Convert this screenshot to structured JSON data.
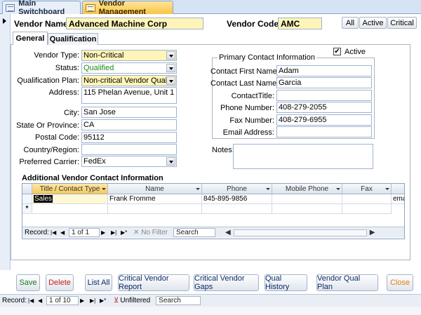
{
  "tabs": [
    {
      "label": "Main Switchboard"
    },
    {
      "label": "Vendor Management"
    }
  ],
  "header": {
    "vendor_name_label": "Vendor Name:",
    "vendor_name": "Advanced Machine Corp",
    "vendor_code_label": "Vendor Code:",
    "vendor_code": "AMC",
    "filter_buttons": [
      "All",
      "Active",
      "Critical"
    ]
  },
  "page_tabs": [
    "General",
    "Qualification"
  ],
  "general": {
    "vendor_type": {
      "label": "Vendor Type:",
      "value": "Non-Critical"
    },
    "status": {
      "label": "Status:",
      "value": "Qualified"
    },
    "qual_plan": {
      "label": "Qualification Plan:",
      "value": "Non-critical Vendor Qual"
    },
    "address": {
      "label": "Address:",
      "value": "115 Phelan Avenue, Unit 1"
    },
    "city": {
      "label": "City:",
      "value": "San Jose"
    },
    "state": {
      "label": "State Or Province:",
      "value": "CA"
    },
    "postal": {
      "label": "Postal Code:",
      "value": "95112"
    },
    "country": {
      "label": "Country/Region:",
      "value": ""
    },
    "carrier": {
      "label": "Preferred Carrier:",
      "value": "FedEx"
    }
  },
  "primary_contact": {
    "title": "Primary Contact Information",
    "active_label": "Active",
    "active_checked": true,
    "first_name": {
      "label": "Contact First Name:",
      "value": "Adam"
    },
    "last_name": {
      "label": "Contact Last Name:",
      "value": "Garcia"
    },
    "contact_title": {
      "label": "ContactTitle:",
      "value": ""
    },
    "phone": {
      "label": "Phone Number:",
      "value": "408-279-2055"
    },
    "fax": {
      "label": "Fax Number:",
      "value": "408-279-6955"
    },
    "email": {
      "label": "Email Address:",
      "value": ""
    }
  },
  "notes": {
    "label": "Notes:",
    "value": ""
  },
  "additional": {
    "title": "Additional Vendor Contact Information",
    "columns": [
      "Title / Contact Type",
      "Name",
      "Phone",
      "Mobile Phone",
      "Fax"
    ],
    "row": {
      "title": "Sales",
      "name": "Frank Fromme",
      "phone": "845-895-9856",
      "mobile": "",
      "fax": "",
      "overflow": "ema"
    },
    "new_row_marker": "*",
    "nav": {
      "record_label": "Record:",
      "position": "1 of 1",
      "filter": "No Filter",
      "search": "Search"
    }
  },
  "footer_buttons": [
    {
      "label": "Save",
      "color": "#1a7a1a"
    },
    {
      "label": "Delete",
      "color": "#c0201a"
    },
    {
      "label": "List All",
      "color": "#0c2a66"
    },
    {
      "label": "Critical Vendor Report",
      "color": "#0c2a66"
    },
    {
      "label": "Critical Vendor Gaps",
      "color": "#0c2a66"
    },
    {
      "label": "Qual History",
      "color": "#0c2a66"
    },
    {
      "label": "Vendor Qual Plan",
      "color": "#0c2a66"
    },
    {
      "label": "Close",
      "color": "#e07a10"
    }
  ],
  "bottom_nav": {
    "record_label": "Record:",
    "position": "1 of 10",
    "filter": "Unfiltered",
    "search": "Search"
  }
}
